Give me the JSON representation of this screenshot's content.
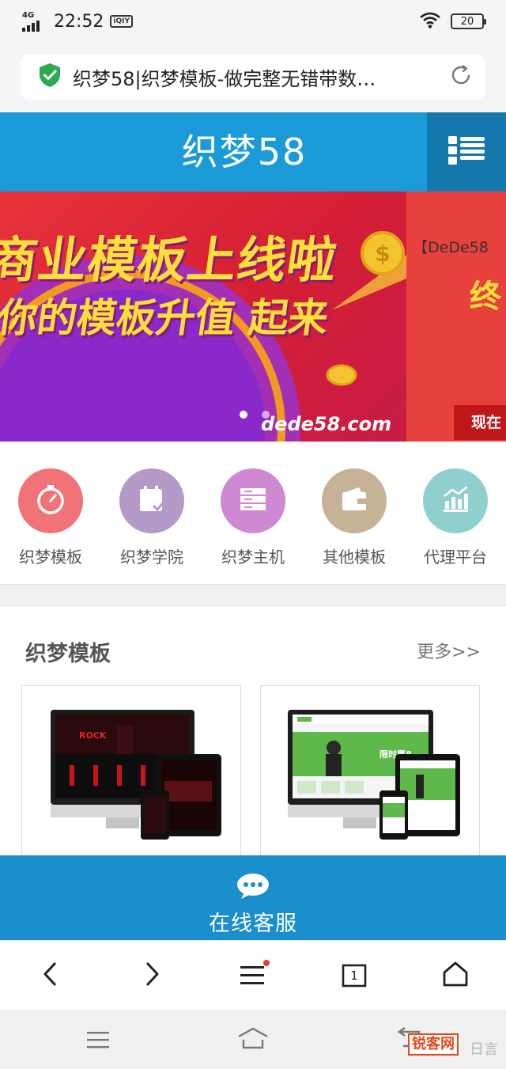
{
  "status_bar": {
    "network": "4G",
    "time": "22:52",
    "app_badge": "iQIY",
    "battery": "20"
  },
  "address_bar": {
    "page_title": "织梦58|织梦模板-做完整无错带数…"
  },
  "site_header": {
    "logo": "织梦58"
  },
  "banner": {
    "headline": "商业模板上线啦",
    "subline": "你的模板升值 起来",
    "site": "dede58.com",
    "next_slide_tag": "【DeDe58",
    "next_slide_big": "终",
    "next_slide_button": "现在"
  },
  "nav": [
    {
      "label": "织梦模板",
      "icon": "stopwatch-icon",
      "color": "#f27377"
    },
    {
      "label": "织梦学院",
      "icon": "calendar-icon",
      "color": "#b49ac7"
    },
    {
      "label": "织梦主机",
      "icon": "server-icon",
      "color": "#cf88d2"
    },
    {
      "label": "其他模板",
      "icon": "wallet-icon",
      "color": "#c6b296"
    },
    {
      "label": "代理平台",
      "icon": "chart-icon",
      "color": "#8fd0cf"
    }
  ],
  "section": {
    "title": "织梦模板",
    "more": "更多>>"
  },
  "cards": [
    {
      "name": "rock-template",
      "screen_text": "ROCK",
      "theme": "#111111",
      "accent": "#c8141b"
    },
    {
      "name": "green-template",
      "screen_text": "限时惠8",
      "theme": "#5fb84a",
      "accent": "#3a9a2e"
    }
  ],
  "service": {
    "label": "在线客服"
  },
  "toolbar": {
    "tab_count": "1"
  },
  "watermark": {
    "badge": "锐客网",
    "faded": "日言"
  }
}
